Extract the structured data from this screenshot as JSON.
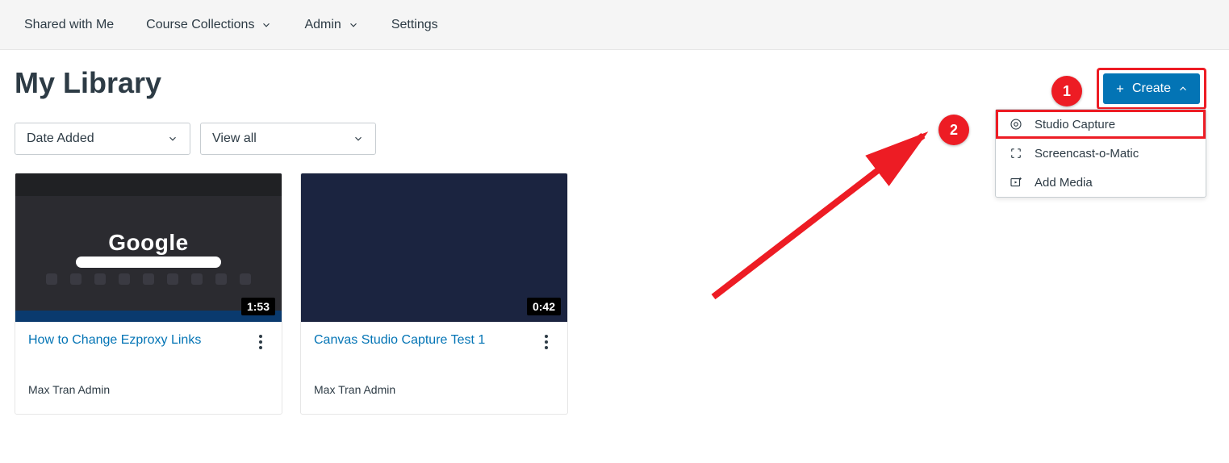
{
  "nav": {
    "shared": "Shared with Me",
    "collections": "Course Collections",
    "admin": "Admin",
    "settings": "Settings"
  },
  "page_title": "My Library",
  "filters": {
    "sort_label": "Date Added",
    "view_label": "View all"
  },
  "create": {
    "button_label": "Create",
    "items": [
      {
        "icon": "record",
        "label": "Studio Capture"
      },
      {
        "icon": "screencast",
        "label": "Screencast-o-Matic"
      },
      {
        "icon": "media",
        "label": "Add Media"
      }
    ]
  },
  "annotations": {
    "step1": "1",
    "step2": "2"
  },
  "cards": [
    {
      "title": "How to Change Ezproxy Links",
      "author": "Max Tran Admin",
      "duration": "1:53",
      "thumb": "google"
    },
    {
      "title": "Canvas Studio Capture Test 1",
      "author": "Max Tran Admin",
      "duration": "0:42",
      "thumb": "editor"
    }
  ]
}
